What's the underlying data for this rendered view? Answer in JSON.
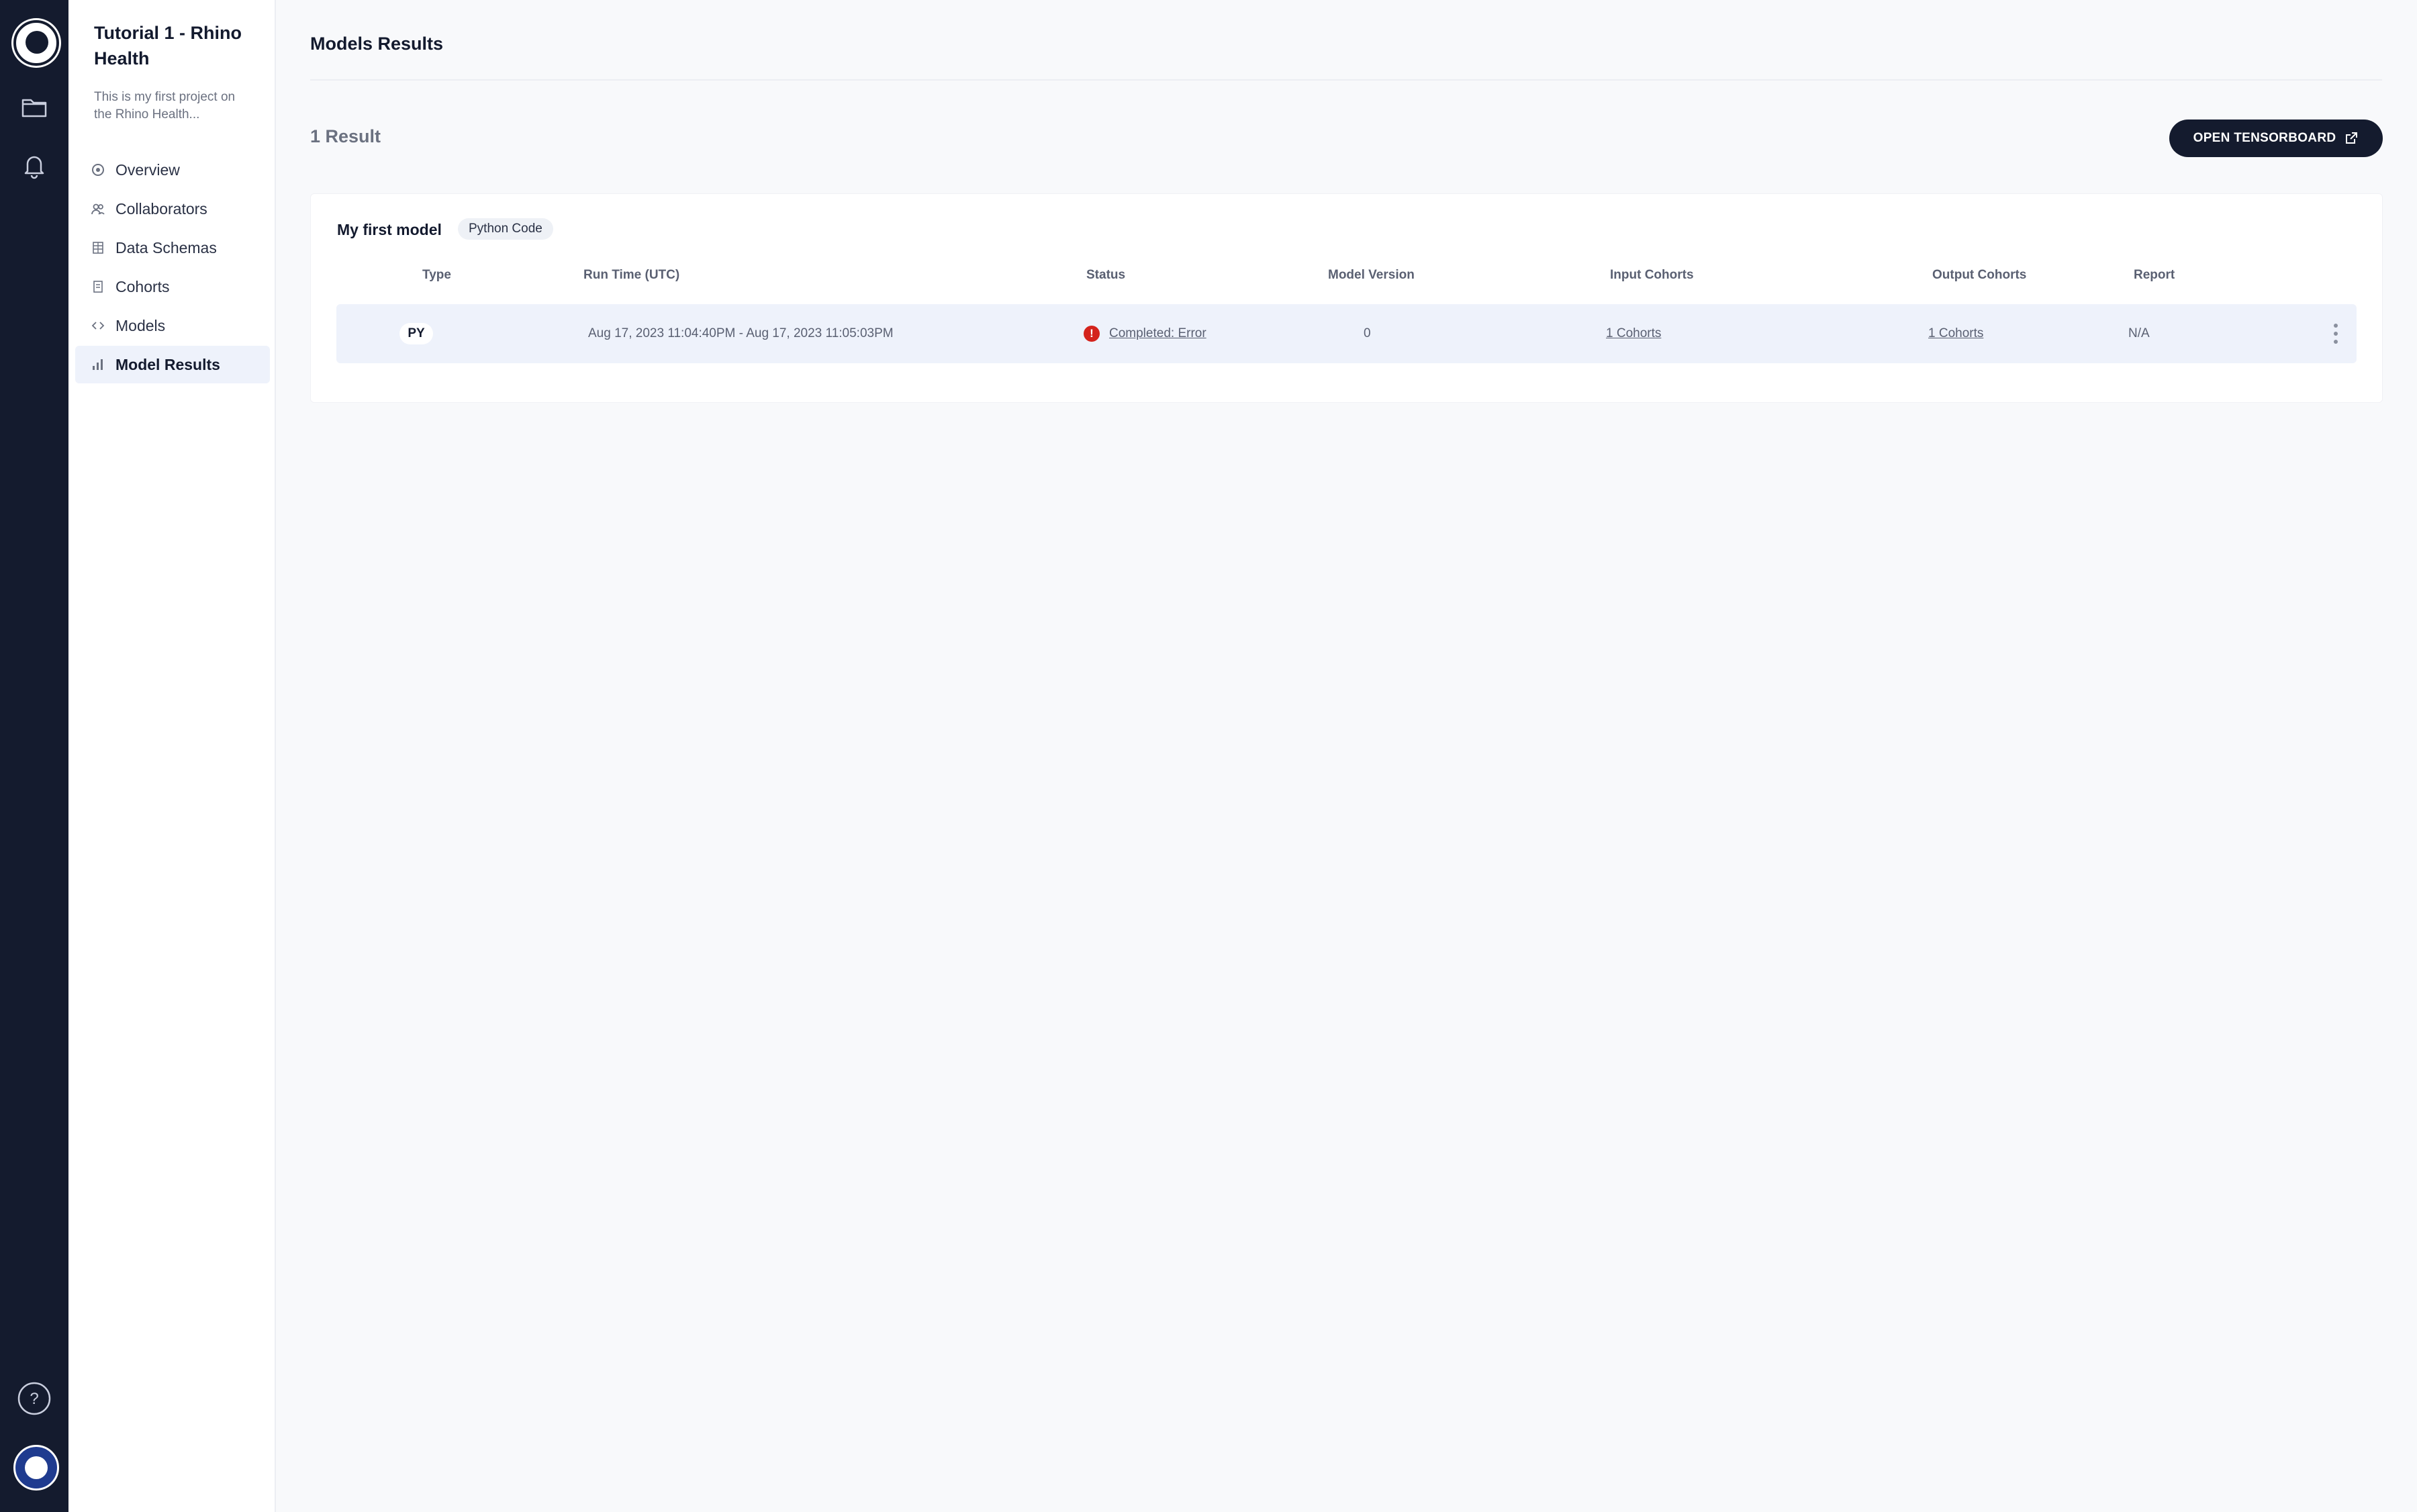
{
  "project": {
    "title": "Tutorial 1 - Rhino Health",
    "description": "This is my first project on the Rhino Health..."
  },
  "nav": {
    "items": [
      {
        "label": "Overview",
        "icon": "overview-icon"
      },
      {
        "label": "Collaborators",
        "icon": "collaborators-icon"
      },
      {
        "label": "Data Schemas",
        "icon": "table-icon"
      },
      {
        "label": "Cohorts",
        "icon": "document-icon"
      },
      {
        "label": "Models",
        "icon": "code-icon"
      },
      {
        "label": "Model Results",
        "icon": "bar-chart-icon",
        "active": true
      }
    ]
  },
  "page": {
    "title": "Models Results",
    "result_count": "1 Result",
    "tensorboard_button": "OPEN TENSORBOARD"
  },
  "model": {
    "name": "My first model",
    "tag": "Python Code"
  },
  "table": {
    "headers": {
      "type": "Type",
      "run_time": "Run Time (UTC)",
      "status": "Status",
      "model_version": "Model Version",
      "input_cohorts": "Input Cohorts",
      "output_cohorts": "Output Cohorts",
      "report": "Report"
    },
    "rows": [
      {
        "type": "PY",
        "run_time": "Aug 17, 2023 11:04:40PM - Aug 17, 2023 11:05:03PM",
        "status": "Completed: Error",
        "model_version": "0",
        "input_cohorts": "1 Cohorts",
        "output_cohorts": "1 Cohorts",
        "report": "N/A"
      }
    ]
  },
  "colors": {
    "rail": "#141b2e",
    "accent": "#141b2e",
    "error": "#d4231c",
    "row_highlight": "#eef2fb"
  }
}
